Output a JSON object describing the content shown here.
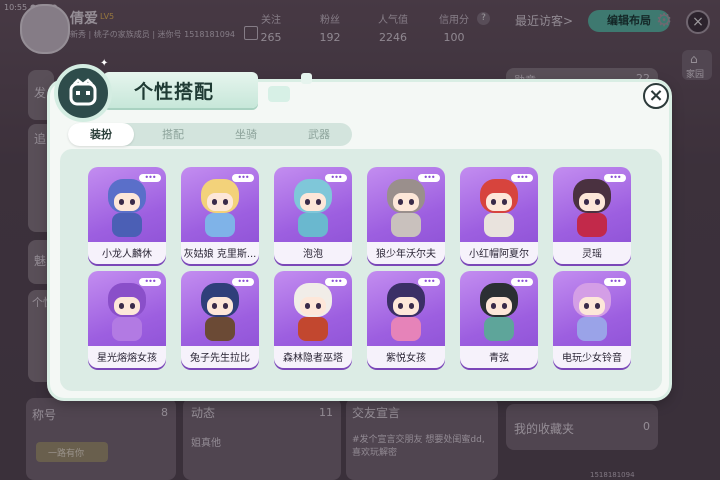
{
  "status_bar": {
    "time": "10:55"
  },
  "profile": {
    "name": "倩爱",
    "level": "LV5",
    "subtitle": "新秀 | 桃子の家族成员 | 迷你号 1518181094"
  },
  "stats": [
    {
      "label": "关注",
      "value": "265"
    },
    {
      "label": "粉丝",
      "value": "192"
    },
    {
      "label": "人气值",
      "value": "2246"
    },
    {
      "label": "信用分",
      "value": "100"
    }
  ],
  "recent_visitors": "最近访客>",
  "edit_layout_button": "编辑布局",
  "home_button": "家园",
  "background_sections": {
    "medal": {
      "label": "勋章",
      "count": "22"
    },
    "left_stub_1": "发",
    "left_stub_2": "追",
    "left_stub_3": "魅",
    "left_stub_4": "个性",
    "title_section": {
      "label": "称号",
      "count": "8"
    },
    "title_badge": "一路有你",
    "dynamics": {
      "label": "动态",
      "count": "11"
    },
    "dynamics_text": "姐真他",
    "friend_declaration": {
      "label": "交友宣言",
      "text": "#发个宣言交朋友 想要处闺蜜dd,喜欢玩解密"
    },
    "favorites": {
      "label": "我的收藏夹",
      "count": "0"
    },
    "bottom_id": "1518181094"
  },
  "modal": {
    "title": "个性搭配",
    "close_label": "×",
    "tabs": [
      {
        "label": "装扮",
        "active": true
      },
      {
        "label": "搭配",
        "active": false
      },
      {
        "label": "坐骑",
        "active": false
      },
      {
        "label": "武器",
        "active": false
      }
    ],
    "more_label": "•••",
    "skins": [
      {
        "name": "小龙人麟休",
        "hair": "#5a6fc9",
        "outfit": "#4b5fb5"
      },
      {
        "name": "灰姑娘 克里斯...",
        "hair": "#f3d27a",
        "outfit": "#7fb3e8"
      },
      {
        "name": "泡泡",
        "hair": "#7fc7d9",
        "outfit": "#6ab8cf"
      },
      {
        "name": "狼少年沃尔夫",
        "hair": "#9a8f8c",
        "outfit": "#c9c1bd"
      },
      {
        "name": "小红帽阿夏尔",
        "hair": "#d7443d",
        "outfit": "#e9e3dd"
      },
      {
        "name": "灵瑶",
        "hair": "#4a3140",
        "outfit": "#c2294a"
      },
      {
        "name": "星光熔熔女孩",
        "hair": "#8a4fc9",
        "outfit": "#b27ae3"
      },
      {
        "name": "兔子先生拉比",
        "hair": "#2f3f7a",
        "outfit": "#6b4a35"
      },
      {
        "name": "森林隐者巫塔",
        "hair": "#f1ede8",
        "outfit": "#c2472f"
      },
      {
        "name": "紫悦女孩",
        "hair": "#3b2f66",
        "outfit": "#e683b9"
      },
      {
        "name": "青弦",
        "hair": "#2b2f33",
        "outfit": "#5ea59a"
      },
      {
        "name": "电玩少女铃音",
        "hair": "#d49ee6",
        "outfit": "#9aa3e8"
      }
    ]
  }
}
